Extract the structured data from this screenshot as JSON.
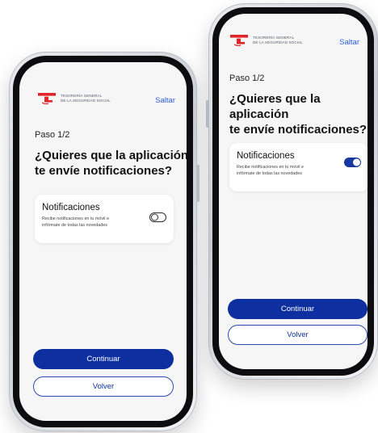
{
  "colors": {
    "brand_red": "#e1252b",
    "primary_blue": "#0d2f9f",
    "link_blue": "#2a5bd7"
  },
  "screens": [
    {
      "logo": {
        "line1": "TESORERÍA GENERAL",
        "line2": "DE LA SEGURIDAD SOCIAL",
        "icon": "tgss-logo-icon"
      },
      "skip_label": "Saltar",
      "step_label": "Paso 1/2",
      "question_line1": "¿Quieres que la aplicación",
      "question_line2": "te envíe notificaciones?",
      "card": {
        "title": "Notificaciones",
        "desc_line1": "Recibe notificaciones en tu móvil e",
        "desc_line2": "infórmate de todas las novedades",
        "toggle_state": "off"
      },
      "continue_label": "Continuar",
      "back_label": "Volver"
    },
    {
      "logo": {
        "line1": "TESORERÍA GENERAL",
        "line2": "DE LA SEGURIDAD SOCIAL",
        "icon": "tgss-logo-icon"
      },
      "skip_label": "Saltar",
      "step_label": "Paso 1/2",
      "question_line1": "¿Quieres que la aplicación",
      "question_line2": "te envíe notificaciones?",
      "card": {
        "title": "Notificaciones",
        "desc_line1": "Recibe notificaciones en tu móvil e",
        "desc_line2": "infórmate de todas las novedades",
        "toggle_state": "on"
      },
      "continue_label": "Continuar",
      "back_label": "Volver"
    }
  ]
}
